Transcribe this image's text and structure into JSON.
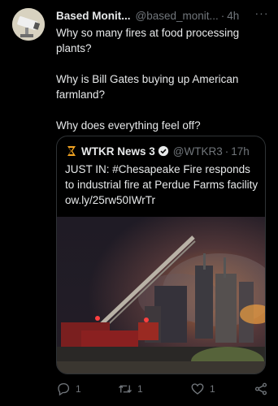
{
  "tweet": {
    "author_name": "Based Monit...",
    "author_handle": "@based_monit...",
    "separator": "·",
    "time": "4h",
    "more_label": "···",
    "paragraphs": [
      "Why so many fires at food processing plants?",
      "Why is Bill Gates buying up American farmland?",
      "Why does everything feel off?"
    ]
  },
  "quoted_tweet": {
    "author_name": "WTKR News 3",
    "author_handle": "@WTKR3",
    "separator": "·",
    "time": "17h",
    "text": "JUST IN: #Chesapeake Fire responds to industrial fire at Perdue Farms facility ow.ly/25rw50IWrTr",
    "media_description_icon": "photo-industrial-fire"
  },
  "actions": {
    "reply_count": "1",
    "retweet_count": "1",
    "like_count": "1"
  },
  "colors": {
    "background": "#000000",
    "text_primary": "#e7e9ea",
    "text_secondary": "#71767b",
    "border": "#2f3336",
    "verified": "#1d9bf0"
  }
}
